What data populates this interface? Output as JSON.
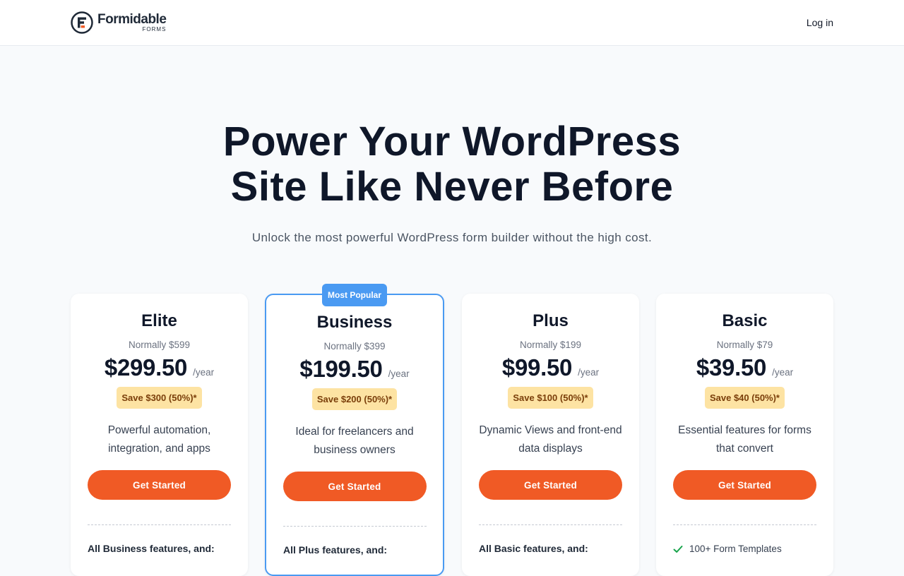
{
  "header": {
    "logo_name": "Formidable",
    "logo_sub": "FORMS",
    "login_label": "Log in"
  },
  "hero": {
    "title_line1": "Power Your WordPress",
    "title_line2": "Site Like Never Before",
    "subtitle": "Unlock the most powerful WordPress form builder without the high cost."
  },
  "colors": {
    "accent": "#f05a25",
    "popular_border": "#4a9af2",
    "save_bg": "#fde3a3",
    "check": "#16a34a"
  },
  "plans": [
    {
      "name": "Elite",
      "normally": "Normally $599",
      "price": "$299.50",
      "per": "/year",
      "save": "Save $300 (50%)*",
      "desc": "Powerful automation, integration, and apps",
      "cta": "Get Started",
      "features_head": "All Business features, and:"
    },
    {
      "name": "Business",
      "badge": "Most Popular",
      "normally": "Normally $399",
      "price": "$199.50",
      "per": "/year",
      "save": "Save $200 (50%)*",
      "desc": "Ideal for freelancers and business owners",
      "cta": "Get Started",
      "features_head": "All Plus features, and:"
    },
    {
      "name": "Plus",
      "normally": "Normally $199",
      "price": "$99.50",
      "per": "/year",
      "save": "Save $100 (50%)*",
      "desc": "Dynamic Views and front-end data displays",
      "cta": "Get Started",
      "features_head": "All Basic features, and:"
    },
    {
      "name": "Basic",
      "normally": "Normally $79",
      "price": "$39.50",
      "per": "/year",
      "save": "Save $40 (50%)*",
      "desc": "Essential features for forms that convert",
      "cta": "Get Started",
      "features": [
        {
          "icon": "check-icon",
          "label": "100+ Form Templates"
        }
      ]
    }
  ]
}
